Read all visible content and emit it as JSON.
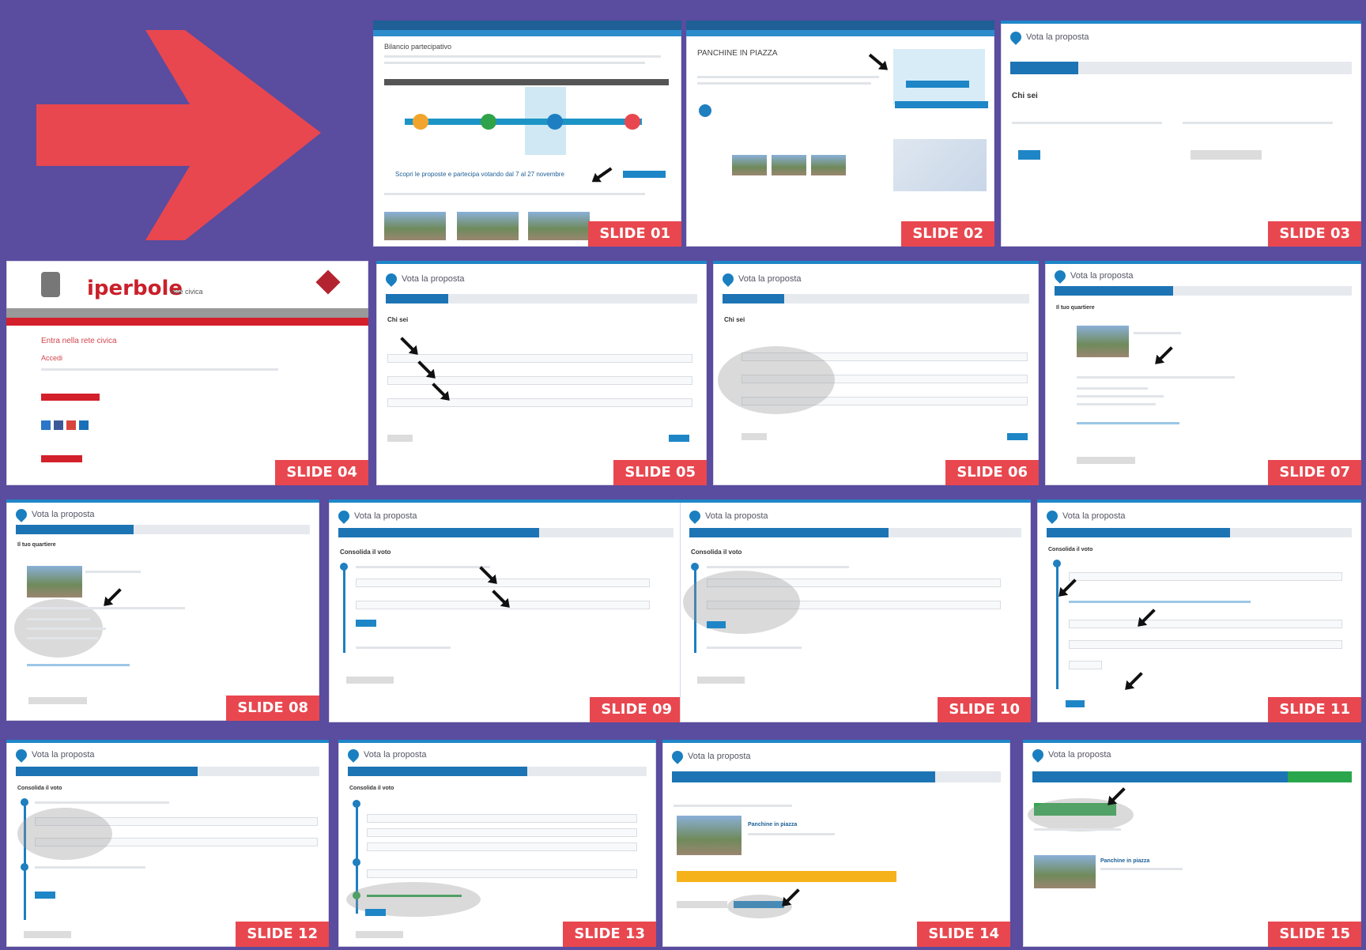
{
  "slides": [
    {
      "label": "SLIDE 01"
    },
    {
      "label": "SLIDE 02"
    },
    {
      "label": "SLIDE 03"
    },
    {
      "label": "SLIDE 04"
    },
    {
      "label": "SLIDE 05"
    },
    {
      "label": "SLIDE 06"
    },
    {
      "label": "SLIDE 07"
    },
    {
      "label": "SLIDE 08"
    },
    {
      "label": "SLIDE 09"
    },
    {
      "label": "SLIDE 10"
    },
    {
      "label": "SLIDE 11"
    },
    {
      "label": "SLIDE 12"
    },
    {
      "label": "SLIDE 13"
    },
    {
      "label": "SLIDE 14"
    },
    {
      "label": "SLIDE 15"
    }
  ],
  "vote_title": "Vota la proposta",
  "slide01": {
    "heading": "Bilancio partecipativo",
    "cta": "Scopri le proposte e partecipa votando dal 7 al 27 novembre"
  },
  "slide02": {
    "heading": "PANCHINE IN PIAZZA"
  },
  "slide03": {
    "section": "Chi sei"
  },
  "slide04": {
    "brand": "iperbole",
    "brand_sub": "rete civica",
    "heading": "Entra nella rete civica",
    "sub": "Accedi"
  },
  "slide05": {
    "section": "Chi sei"
  },
  "slide06": {
    "section": "Chi sei"
  },
  "slide07": {
    "section": "Il tuo quartiere"
  },
  "slide08": {
    "section": "Il tuo quartiere"
  },
  "slide09": {
    "section": "Consolida il voto"
  },
  "slide10": {
    "section": "Consolida il voto"
  },
  "slide11": {
    "section": "Consolida il voto"
  },
  "slide12": {
    "section": "Consolida il voto"
  },
  "slide13": {
    "section": "Consolida il voto"
  },
  "slide15": {
    "item": "Panchine in piazza"
  },
  "slide14": {
    "item": "Panchine in piazza"
  },
  "colors": {
    "background": "#5a4c9f",
    "label": "#e8474f",
    "arrow": "#e8474f",
    "accent": "#1f87c8"
  }
}
